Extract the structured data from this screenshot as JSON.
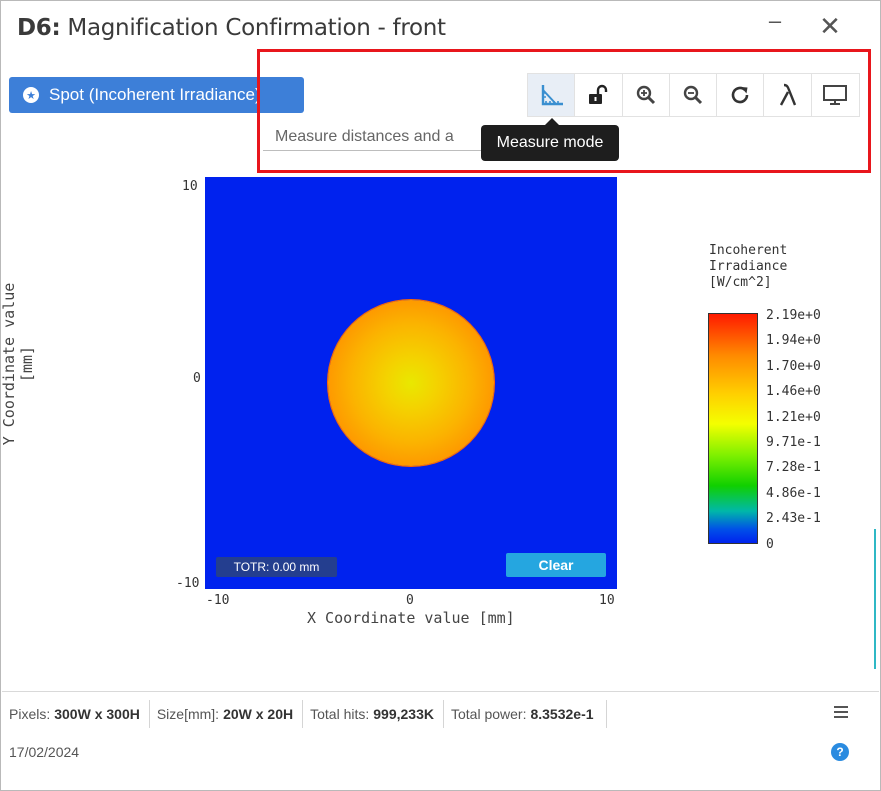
{
  "window": {
    "title_bold": "D6:",
    "title_rest": " Magnification Confirmation - front",
    "minimize_glyph": "–",
    "close_glyph": "✕"
  },
  "analysis_button": {
    "label": "Spot (Incoherent Irradiance)",
    "icon": "circle-star-icon"
  },
  "toolbar": {
    "tools": [
      {
        "name": "measure-mode-icon",
        "active": true
      },
      {
        "name": "unlock-icon",
        "active": false
      },
      {
        "name": "zoom-in-icon",
        "active": false
      },
      {
        "name": "zoom-out-icon",
        "active": false
      },
      {
        "name": "refresh-icon",
        "active": false
      },
      {
        "name": "lambda-icon",
        "active": false
      },
      {
        "name": "monitor-icon",
        "active": false
      }
    ],
    "measure_select_text": "Measure distances and a",
    "tooltip": "Measure mode"
  },
  "plot": {
    "ylabel": "Y Coordinate value [mm]",
    "xlabel": "X Coordinate value [mm]",
    "yticks": [
      "10",
      "0",
      "-10"
    ],
    "xticks": [
      "-10",
      "0",
      "10"
    ],
    "totr_label": "TOTR: 0.00 mm",
    "clear_label": "Clear",
    "colors": {
      "background": "#0022ee",
      "spot_center": "#e9e800",
      "spot_edge": "#ff5000"
    }
  },
  "legend": {
    "title_lines": [
      "Incoherent",
      "Irradiance",
      "[W/cm^2]"
    ],
    "ticks": [
      "2.19e+0",
      "1.94e+0",
      "1.70e+0",
      "1.46e+0",
      "1.21e+0",
      "9.71e-1",
      "7.28e-1",
      "4.86e-1",
      "2.43e-1",
      "0"
    ]
  },
  "status": {
    "pixels_label": "Pixels:",
    "pixels_value": "300W x 300H",
    "size_label": "Size[mm]:",
    "size_value": "20W x 20H",
    "hits_label": "Total hits:",
    "hits_value": "999,233K",
    "power_label": "Total power:",
    "power_value": "8.3532e-1",
    "date": "17/02/2024",
    "help_glyph": "?"
  }
}
